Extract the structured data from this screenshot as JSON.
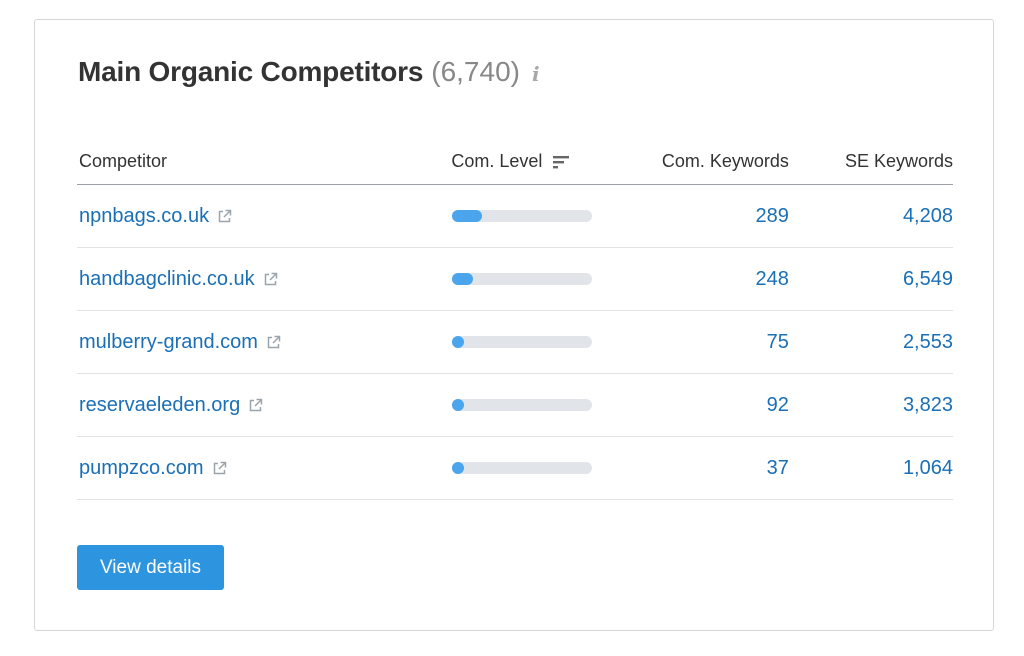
{
  "widget": {
    "title": "Main Organic Competitors",
    "count": "(6,740)",
    "info_icon": "info-icon",
    "accent_color": "#2d94e0",
    "link_color": "#1a6fb5"
  },
  "table": {
    "headers": {
      "competitor": "Competitor",
      "com_level": "Com. Level",
      "com_keywords": "Com. Keywords",
      "se_keywords": "SE Keywords"
    },
    "rows": [
      {
        "domain": "npnbags.co.uk",
        "com_level": 0.21,
        "com_keywords": "289",
        "se_keywords": "4,208"
      },
      {
        "domain": "handbagclinic.co.uk",
        "com_level": 0.15,
        "com_keywords": "248",
        "se_keywords": "6,549"
      },
      {
        "domain": "mulberry-grand.com",
        "com_level": 0.08,
        "com_keywords": "75",
        "se_keywords": "2,553"
      },
      {
        "domain": "reservaeleden.org",
        "com_level": 0.08,
        "com_keywords": "92",
        "se_keywords": "3,823"
      },
      {
        "domain": "pumpzco.com",
        "com_level": 0.08,
        "com_keywords": "37",
        "se_keywords": "1,064"
      }
    ]
  },
  "actions": {
    "view_details_label": "View details"
  }
}
